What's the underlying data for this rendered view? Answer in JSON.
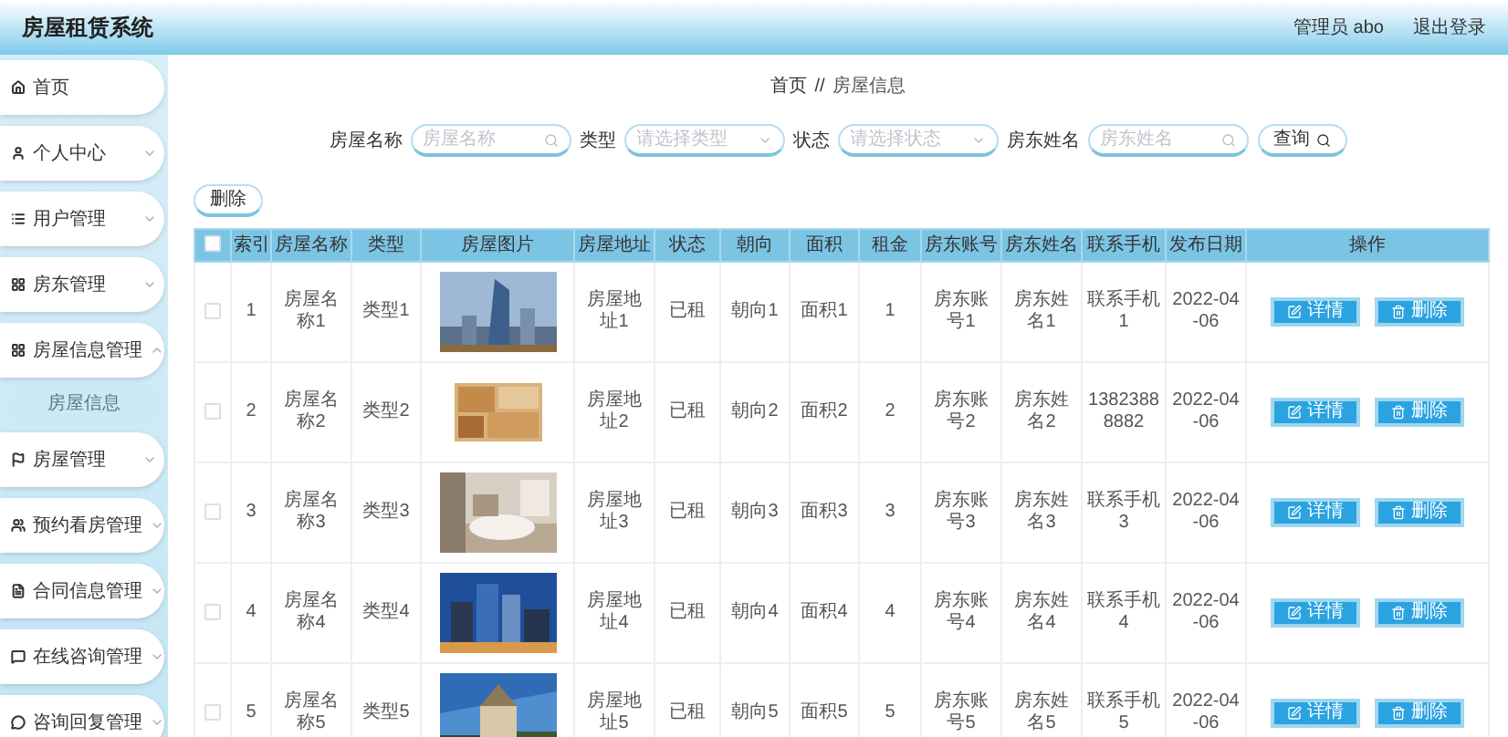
{
  "header": {
    "title": "房屋租赁系统",
    "user": "管理员 abo",
    "logout": "退出登录"
  },
  "sidebar": {
    "items": [
      {
        "label": "首页"
      },
      {
        "label": "个人中心",
        "expanded": false
      },
      {
        "label": "用户管理",
        "expanded": false
      },
      {
        "label": "房东管理",
        "expanded": false
      },
      {
        "label": "房屋信息管理",
        "expanded": true,
        "children": [
          {
            "label": "房屋信息",
            "selected": true
          }
        ]
      },
      {
        "label": "房屋管理",
        "expanded": false
      },
      {
        "label": "预约看房管理",
        "expanded": false
      },
      {
        "label": "合同信息管理",
        "expanded": false
      },
      {
        "label": "在线咨询管理",
        "expanded": false
      },
      {
        "label": "咨询回复管理",
        "expanded": false
      }
    ]
  },
  "breadcrumb": {
    "items": [
      "首页",
      "房屋信息"
    ],
    "separator": "//"
  },
  "search": {
    "filters": [
      {
        "label": "房屋名称",
        "placeholder": "房屋名称",
        "kind": "text"
      },
      {
        "label": "类型",
        "placeholder": "请选择类型",
        "kind": "select"
      },
      {
        "label": "状态",
        "placeholder": "请选择状态",
        "kind": "select"
      },
      {
        "label": "房东姓名",
        "placeholder": "房东姓名",
        "kind": "text"
      }
    ],
    "button": "查询"
  },
  "delete_button": "删除",
  "table": {
    "header_checked": false,
    "columns": [
      "索引",
      "房屋名称",
      "类型",
      "房屋图片",
      "房屋地址",
      "状态",
      "朝向",
      "面积",
      "租金",
      "房东账号",
      "房东姓名",
      "联系手机",
      "发布日期",
      "操作"
    ],
    "rows": [
      {
        "checked": false,
        "cells": [
          "1",
          "房屋名称1",
          "类型1",
          {
            "kind": "picture"
          },
          "房屋地址1",
          "已租",
          "朝向1",
          "面积1",
          "1",
          "房东账号1",
          "房东姓名1",
          "联系手机1",
          "2022-04-06"
        ],
        "actions": [
          "详情",
          "删除"
        ]
      },
      {
        "checked": false,
        "cells": [
          "2",
          "房屋名称2",
          "类型2",
          {
            "kind": "picture"
          },
          "房屋地址2",
          "已租",
          "朝向2",
          "面积2",
          "2",
          "房东账号2",
          "房东姓名2",
          "13823888882",
          "2022-04-06"
        ],
        "actions": [
          "详情",
          "删除"
        ]
      },
      {
        "checked": false,
        "cells": [
          "3",
          "房屋名称3",
          "类型3",
          {
            "kind": "picture"
          },
          "房屋地址3",
          "已租",
          "朝向3",
          "面积3",
          "3",
          "房东账号3",
          "房东姓名3",
          "联系手机3",
          "2022-04-06"
        ],
        "actions": [
          "详情",
          "删除"
        ]
      },
      {
        "checked": false,
        "cells": [
          "4",
          "房屋名称4",
          "类型4",
          {
            "kind": "picture"
          },
          "房屋地址4",
          "已租",
          "朝向4",
          "面积4",
          "4",
          "房东账号4",
          "房东姓名4",
          "联系手机4",
          "2022-04-06"
        ],
        "actions": [
          "详情",
          "删除"
        ]
      },
      {
        "checked": false,
        "cells": [
          "5",
          "房屋名称5",
          "类型5",
          {
            "kind": "picture"
          },
          "房屋地址5",
          "已租",
          "朝向5",
          "面积5",
          "5",
          "房东账号5",
          "房东姓名5",
          "联系手机5",
          "2022-04-06"
        ],
        "actions": [
          "详情",
          "删除"
        ]
      }
    ]
  }
}
